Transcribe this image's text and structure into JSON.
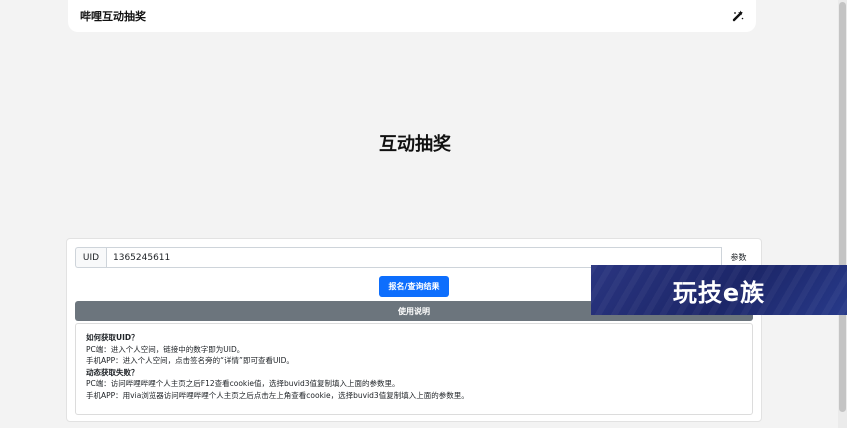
{
  "header": {
    "brand": "哔哩互动抽奖",
    "theme_icon": "magic-wand-icon"
  },
  "hero": {
    "title": "互动抽奖"
  },
  "form": {
    "uid_label": "UID",
    "uid_value": "1365245611",
    "param_label": "参数",
    "submit_label": "报名/查询结果",
    "instructions_label": "使用说明"
  },
  "help": {
    "lines": [
      {
        "text": "如何获取UID？",
        "bold": true
      },
      {
        "text": "PC端：进入个人空间，链接中的数字即为UID。",
        "bold": false
      },
      {
        "text": "手机APP：进入个人空间，点击签名旁的“详情”即可查看UID。",
        "bold": false
      },
      {
        "text": "动态获取失败？",
        "bold": true
      },
      {
        "text": "PC端：访问哔哩哔哩个人主页之后F12查看cookie值，选择buvid3值复制填入上面的参数里。",
        "bold": false
      },
      {
        "text": "手机APP：用via浏览器访问哔哩哔哩个人主页之后点击左上角查看cookie，选择buvid3值复制填入上面的参数里。",
        "bold": false
      }
    ]
  },
  "watermark": {
    "text": "玩技e族"
  },
  "colors": {
    "primary": "#0d6efd",
    "secondary": "#6c757d",
    "watermark_bg": "#1c2668"
  }
}
